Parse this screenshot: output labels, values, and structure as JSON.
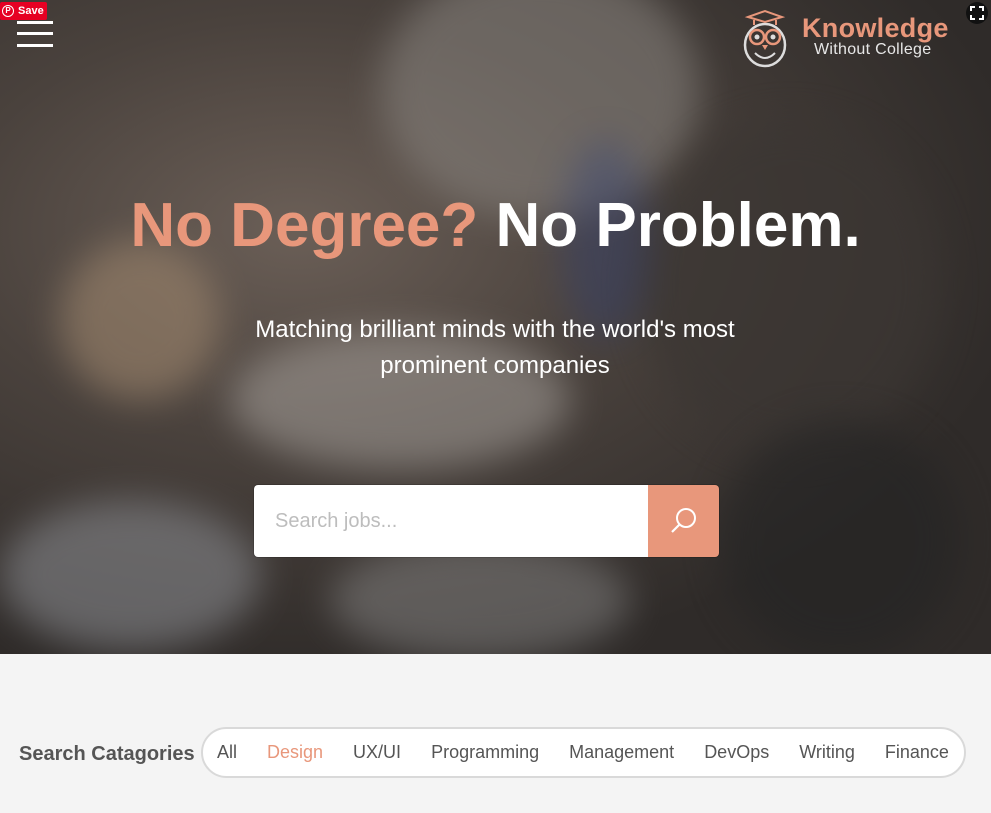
{
  "pinterest": {
    "save_label": "Save",
    "logo_glyph": "P"
  },
  "brand": {
    "title": "Knowledge",
    "subtitle": "Without College"
  },
  "hero": {
    "headline_accent": "No Degree?",
    "headline_plain": "No Problem.",
    "tagline": "Matching brilliant minds with the world's most prominent companies"
  },
  "search": {
    "placeholder": "Search jobs...",
    "value": ""
  },
  "categories": {
    "label": "Search Catagories",
    "active_index": 1,
    "items": [
      "All",
      "Design",
      "UX/UI",
      "Programming",
      "Management",
      "DevOps",
      "Writing",
      "Finance"
    ]
  },
  "colors": {
    "accent": "#e8977b",
    "pinterest_red": "#e60023",
    "section_bg": "#f4f4f4"
  },
  "icons": [
    "hamburger-icon",
    "owl-logo-icon",
    "search-icon",
    "fullscreen-icon",
    "pinterest-icon"
  ]
}
